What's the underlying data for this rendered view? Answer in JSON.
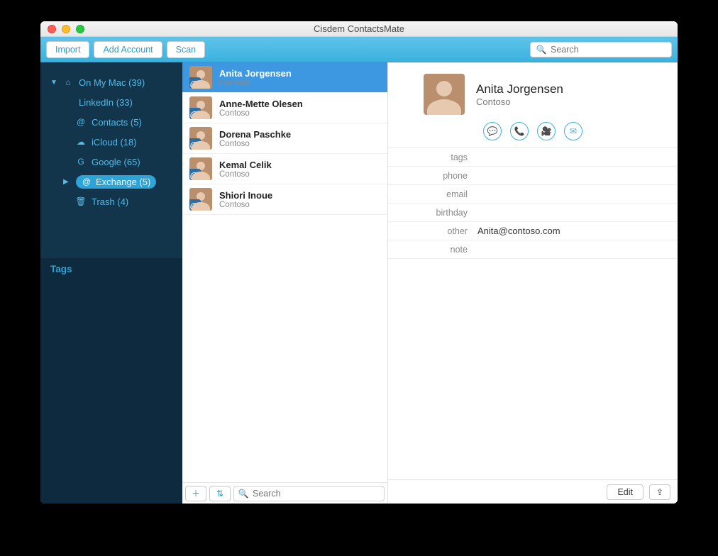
{
  "window": {
    "title": "Cisdem ContactsMate"
  },
  "toolbar": {
    "import": "Import",
    "add_account": "Add Account",
    "scan": "Scan",
    "search_placeholder": "Search"
  },
  "sidebar": {
    "tags_header": "Tags",
    "tree": [
      {
        "label": "On My Mac (39)",
        "icon": "home",
        "expanded": true,
        "level": 0,
        "selected": false
      },
      {
        "label": "LinkedIn (33)",
        "icon": "",
        "level": 2,
        "selected": false
      },
      {
        "label": "Contacts (5)",
        "icon": "at",
        "level": 1,
        "selected": false
      },
      {
        "label": "iCloud (18)",
        "icon": "cloud",
        "level": 1,
        "selected": false
      },
      {
        "label": "Google (65)",
        "icon": "google",
        "level": 1,
        "selected": false
      },
      {
        "label": "Exchange (5)",
        "icon": "at",
        "level": 1,
        "selected": true,
        "expandable": true
      },
      {
        "label": "Trash (4)",
        "icon": "trash",
        "level": 1,
        "selected": false
      }
    ]
  },
  "contacts": [
    {
      "name": "Anita Jorgensen",
      "company": "Contoso",
      "selected": true
    },
    {
      "name": "Anne-Mette Olesen",
      "company": "Contoso",
      "selected": false
    },
    {
      "name": "Dorena Paschke",
      "company": "Contoso",
      "selected": false
    },
    {
      "name": "Kemal Celik",
      "company": "Contoso",
      "selected": false
    },
    {
      "name": "Shiori Inoue",
      "company": "Contoso",
      "selected": false
    }
  ],
  "list_footer": {
    "search_placeholder": "Search"
  },
  "detail": {
    "name": "Anita Jorgensen",
    "company": "Contoso",
    "fields": [
      {
        "label": "tags",
        "value": ""
      },
      {
        "label": "phone",
        "value": ""
      },
      {
        "label": "email",
        "value": ""
      },
      {
        "label": "birthday",
        "value": ""
      },
      {
        "label": "other",
        "value": "Anita@contoso.com"
      },
      {
        "label": "note",
        "value": ""
      }
    ],
    "edit": "Edit"
  },
  "icons": {
    "home": "⌂",
    "at": "@",
    "cloud": "☁",
    "google": "G",
    "trash": "🗑",
    "search": "🔍",
    "plus": "＋",
    "sort": "⇅",
    "share": "⇪",
    "message": "💬",
    "phone": "📞",
    "video": "🎥",
    "mail": "✉"
  }
}
